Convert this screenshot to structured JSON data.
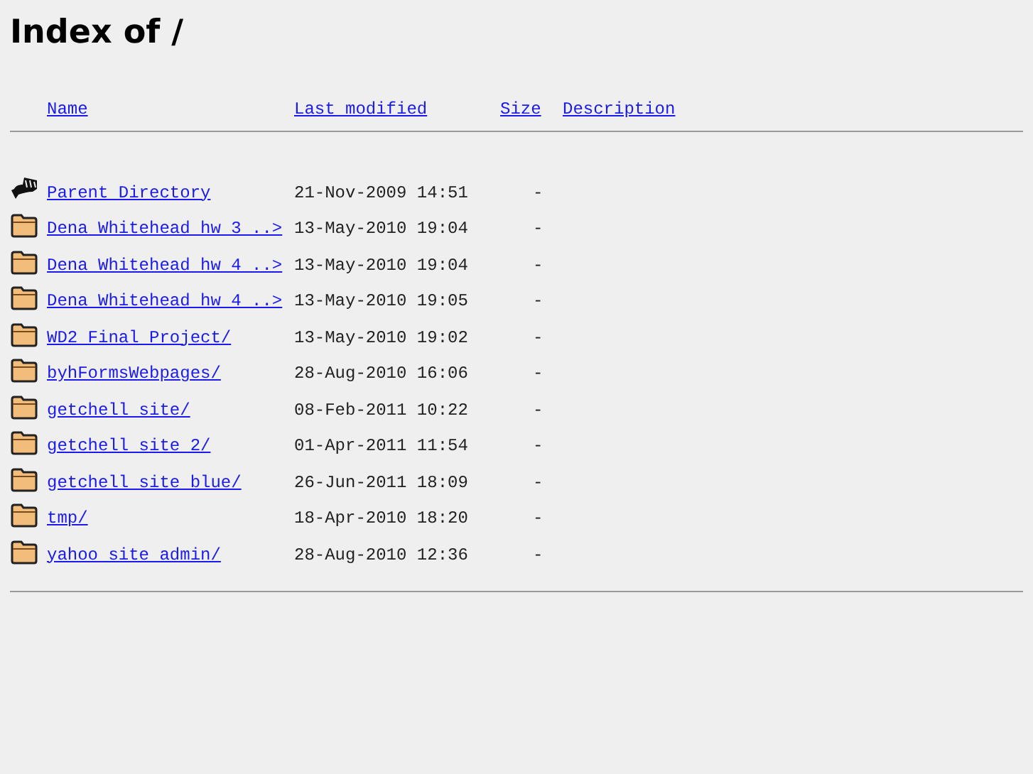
{
  "title": "Index of /",
  "columns": [
    "Name",
    "Last modified",
    "Size",
    "Description"
  ],
  "rows": [
    {
      "kind": "parent",
      "name": "Parent Directory",
      "modified": "21-Nov-2009 14:51",
      "size": "-"
    },
    {
      "kind": "folder",
      "name": "Dena Whitehead hw 3 ..>",
      "modified": "13-May-2010 19:04",
      "size": "-"
    },
    {
      "kind": "folder",
      "name": "Dena Whitehead hw 4 ..>",
      "modified": "13-May-2010 19:04",
      "size": "-"
    },
    {
      "kind": "folder",
      "name": "Dena Whitehead hw 4 ..>",
      "modified": "13-May-2010 19:05",
      "size": "-"
    },
    {
      "kind": "folder",
      "name": "WD2 Final Project/",
      "modified": "13-May-2010 19:02",
      "size": "-"
    },
    {
      "kind": "folder",
      "name": "byhFormsWebpages/",
      "modified": "28-Aug-2010 16:06",
      "size": "-"
    },
    {
      "kind": "folder",
      "name": "getchell site/",
      "modified": "08-Feb-2011 10:22",
      "size": "-"
    },
    {
      "kind": "folder",
      "name": "getchell site 2/",
      "modified": "01-Apr-2011 11:54",
      "size": "-"
    },
    {
      "kind": "folder",
      "name": "getchell site blue/",
      "modified": "26-Jun-2011 18:09",
      "size": "-"
    },
    {
      "kind": "folder",
      "name": "tmp/",
      "modified": "18-Apr-2010 18:20",
      "size": "-"
    },
    {
      "kind": "folder",
      "name": "yahoo site admin/",
      "modified": "28-Aug-2010 12:36",
      "size": "-"
    }
  ]
}
